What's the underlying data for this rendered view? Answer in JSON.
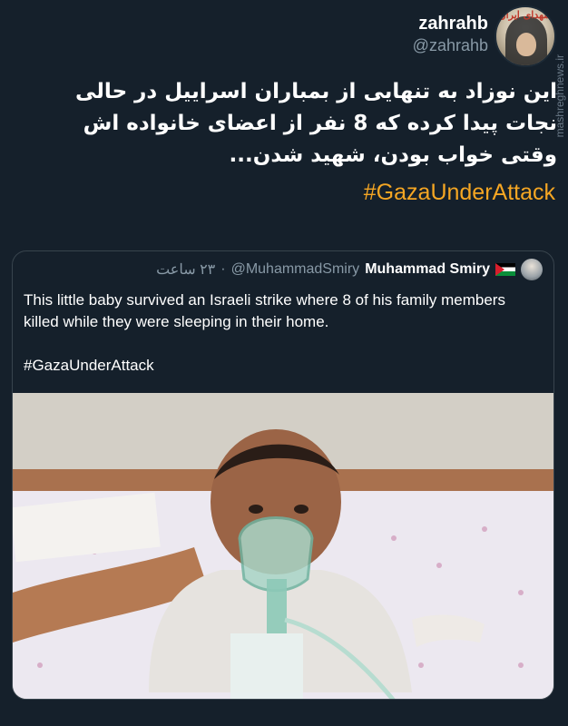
{
  "tweet": {
    "display_name": "zahrahb",
    "handle": "@zahrahb",
    "text_lines": [
      "این نوزاد به تنهایی از بمباران اسراییل در حالی",
      "نجات پیدا کرده که 8 نفر از اعضای خانواده اش",
      "وقتی خواب بودن، شهید شدن..."
    ],
    "hashtag": "#GazaUnderAttack"
  },
  "branding": {
    "avatar_logo_text": "شهدای ایران",
    "watermark": "mashreghnews.ir"
  },
  "quoted_tweet": {
    "display_name": "Muhammad Smiry",
    "handle": "@MuhammadSmiry",
    "separator": "·",
    "time": "٢٣ ساعت",
    "text": "This little baby survived an Israeli strike where 8 of his family members killed while they were sleeping in their home.",
    "hashtag": "#GazaUnderAttack",
    "media": {
      "type": "photo",
      "subject": "infant-with-oxygen-mask"
    }
  },
  "colors": {
    "background": "#15202b",
    "hashtag_accent": "#f5a623",
    "secondary_text": "#8899a6",
    "border": "#38444d"
  }
}
